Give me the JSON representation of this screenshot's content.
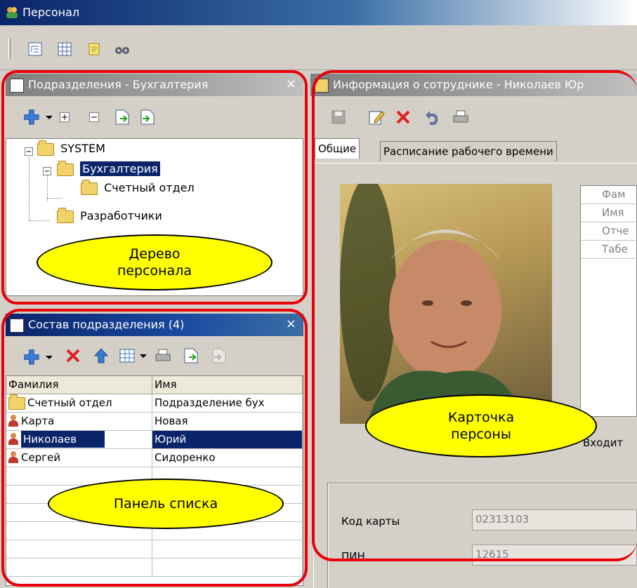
{
  "app": {
    "title": "Персонал"
  },
  "tree_panel": {
    "title": "Подразделения - Бухгалтерия",
    "close": "×",
    "items": [
      {
        "label": "SYSTEM"
      },
      {
        "label": "Бухгалтерия"
      },
      {
        "label": "Счетный отдел"
      },
      {
        "label": "Разработчики"
      }
    ],
    "callout": "Дерево\nперсонала"
  },
  "list_panel": {
    "title": "Состав подразделения (4)",
    "close": "×",
    "columns": [
      "Фамилия",
      "Имя"
    ],
    "rows": [
      {
        "surname": "Счетный отдел",
        "name": "Подразделение бух",
        "kind": "folder"
      },
      {
        "surname": "Карта",
        "name": "Новая",
        "kind": "person"
      },
      {
        "surname": "Николаев",
        "name": "Юрий",
        "kind": "person"
      },
      {
        "surname": "Сергей",
        "name": "Сидоренко",
        "kind": "person"
      }
    ],
    "callout": "Панель списка"
  },
  "info_panel": {
    "title": "Информация о сотруднике - Николаев Юр",
    "tabs": [
      "Общие",
      "Расписание рабочего времени"
    ],
    "fields_table": [
      "Фам",
      "Имя",
      "Отче",
      "Табе"
    ],
    "included_label": "Входит",
    "card_code_label": "Код карты",
    "card_code_value": "02313103",
    "pin_label": "ПИН",
    "pin_value": "12615",
    "callout": "Карточка\nперсоны"
  },
  "colors": {
    "highlight": "#e8000a",
    "callout": "#ffff00",
    "selection": "#0a246a"
  }
}
